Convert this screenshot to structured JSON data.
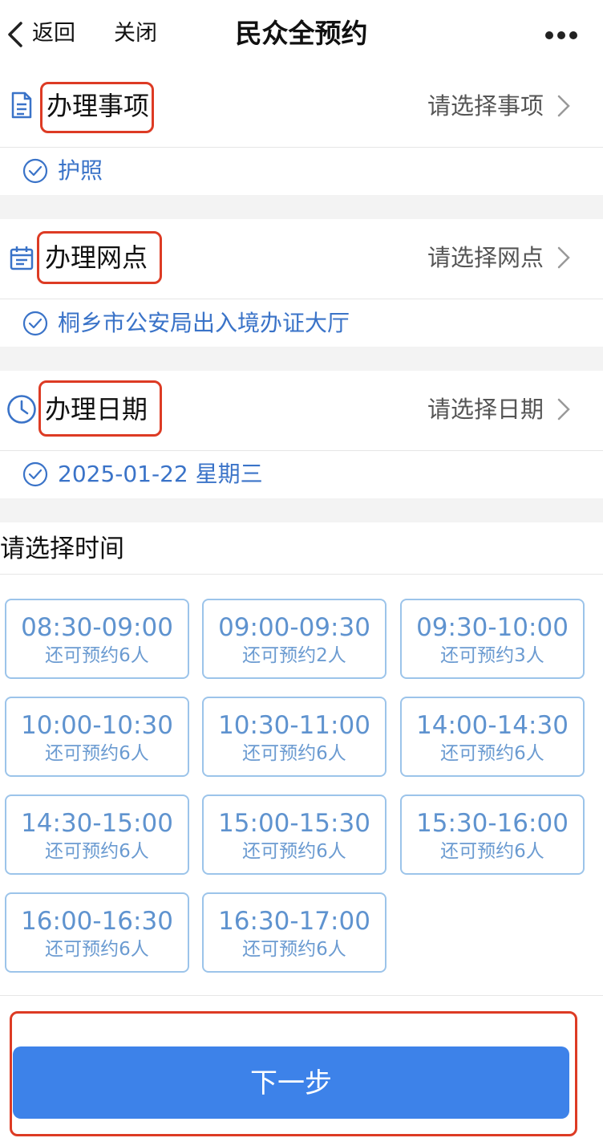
{
  "nav": {
    "back_label": "返回",
    "close_label": "关闭",
    "title": "民众全预约"
  },
  "sections": [
    {
      "label": "办理事项",
      "hint": "请选择事项",
      "selected": "护照",
      "icon": "document-icon"
    },
    {
      "label": "办理网点",
      "hint": "请选择网点",
      "selected": "桐乡市公安局出入境办证大厅",
      "icon": "calendar-icon"
    },
    {
      "label": "办理日期",
      "hint": "请选择日期",
      "selected": "2025-01-22 星期三",
      "icon": "clock-icon"
    }
  ],
  "time_section": {
    "title": "请选择时间",
    "slots": [
      {
        "time": "08:30-09:00",
        "remain": "还可预约6人"
      },
      {
        "time": "09:00-09:30",
        "remain": "还可预约2人"
      },
      {
        "time": "09:30-10:00",
        "remain": "还可预约3人"
      },
      {
        "time": "10:00-10:30",
        "remain": "还可预约6人"
      },
      {
        "time": "10:30-11:00",
        "remain": "还可预约6人"
      },
      {
        "time": "14:00-14:30",
        "remain": "还可预约6人"
      },
      {
        "time": "14:30-15:00",
        "remain": "还可预约6人"
      },
      {
        "time": "15:00-15:30",
        "remain": "还可预约6人"
      },
      {
        "time": "15:30-16:00",
        "remain": "还可预约6人"
      },
      {
        "time": "16:00-16:30",
        "remain": "还可预约6人"
      },
      {
        "time": "16:30-17:00",
        "remain": "还可预约6人"
      }
    ]
  },
  "footer": {
    "next_label": "下一步"
  },
  "colors": {
    "accent": "#3a73c8",
    "button": "#3d82e9",
    "highlight": "#dd3b24",
    "slot_border": "#9cc4ea"
  }
}
